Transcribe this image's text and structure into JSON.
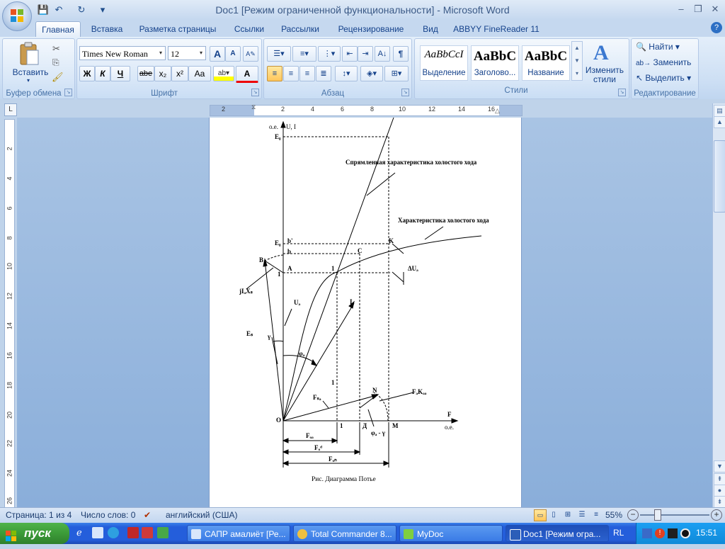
{
  "window": {
    "title": "Doc1 [Режим ограниченной функциональности] - Microsoft Word",
    "minimize": "–",
    "restore": "❐",
    "close": "✕"
  },
  "quick_access": {
    "save": "💾",
    "undo": "↶",
    "redo": "↻",
    "customize": "▾"
  },
  "tabs": [
    "Главная",
    "Вставка",
    "Разметка страницы",
    "Ссылки",
    "Рассылки",
    "Рецензирование",
    "Вид",
    "ABBYY FineReader 11"
  ],
  "ribbon": {
    "clipboard": {
      "label": "Буфер обмена",
      "paste": "Вставить"
    },
    "font": {
      "label": "Шрифт",
      "name": "Times New Roman",
      "size": "12",
      "bold": "Ж",
      "italic": "К",
      "underline": "Ч",
      "strike": "abe",
      "subscript": "x₂",
      "superscript": "x²",
      "case": "Aa",
      "grow": "A",
      "shrink": "A",
      "color": "A"
    },
    "paragraph": {
      "label": "Абзац",
      "show_marks": "¶"
    },
    "styles": {
      "label": "Стили",
      "items": [
        {
          "sample": "AaBbCcI",
          "name": "Выделение"
        },
        {
          "sample": "AaBbC",
          "name": "Заголово..."
        },
        {
          "sample": "AaBbC",
          "name": "Название"
        }
      ],
      "change_styles_1": "Изменить",
      "change_styles_2": "стили"
    },
    "editing": {
      "label": "Редактирование",
      "find": "Найти",
      "replace": "Заменить",
      "select": "Выделить"
    }
  },
  "ruler": {
    "ticks": [
      "2",
      "2",
      "4",
      "6",
      "8",
      "10",
      "12",
      "14",
      "16"
    ]
  },
  "vruler": {
    "ticks": [
      "2",
      "4",
      "6",
      "8",
      "10",
      "12",
      "14",
      "16",
      "18",
      "20",
      "22",
      "24",
      "26"
    ]
  },
  "diagram": {
    "y_axis_label": "U, I",
    "y_unit": "о.е.",
    "x_axis_label": "F",
    "x_unit": "о.е.",
    "label_rectified": "Спрямленная характеристика холостого хода",
    "label_noload": "Характеристика холостого хода",
    "origin": "O",
    "pt_E0": "E₀",
    "pt_Eb": "E₀",
    "pt_b_prime": "b'",
    "pt_b": "b",
    "pt_B": "B",
    "pt_A": "A",
    "pt_1_y": "1",
    "pt_1_curve": "1",
    "pt_C": "C",
    "pt_K": "K",
    "delta_u": "ΔUₐ",
    "jixd": "jIₐXₛ",
    "u_label": "Uₐ",
    "i_label": "Iₐ",
    "e_label": "Eₛ",
    "gamma": "γ",
    "phi": "φₐ",
    "one_mid": "1",
    "fs_label": "Fₛₐ",
    "n_label": "N",
    "fk_label": "FₐKₐₐ",
    "one_x": "1",
    "d_label": "Д",
    "m_label": "M",
    "phi_gamma": "φₐ - γ",
    "f_ob": "Fₒₐ",
    "f_od": "Fₒᵈ",
    "f_oc": "Fₒₙ",
    "caption": "Рис. Диаграмма Потье"
  },
  "status": {
    "page": "Страница: 1 из 4",
    "words": "Число слов: 0",
    "language": "английский (США)",
    "zoom": "55%"
  },
  "taskbar": {
    "start": "пуск",
    "tasks": [
      "САПР амалиёт [Ре...",
      "Total Commander 8...",
      "MyDoc",
      "Doc1 [Режим огра..."
    ],
    "lang": "RL",
    "clock": "15:51"
  }
}
